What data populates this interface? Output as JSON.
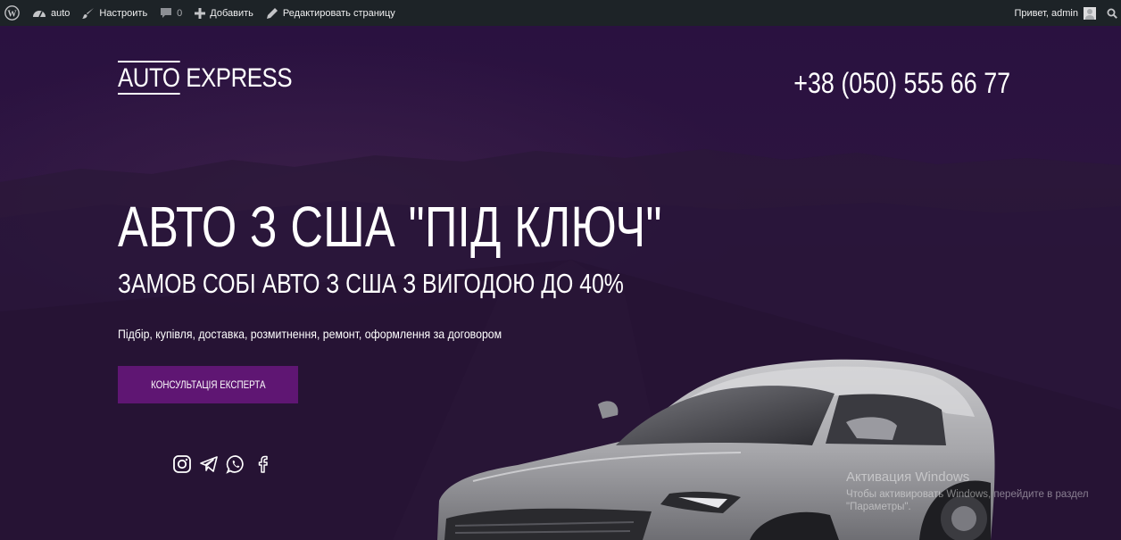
{
  "adminbar": {
    "site_name": "auto",
    "customize": "Настроить",
    "comments_count": "0",
    "new": "Добавить",
    "edit_page": "Редактировать страницу",
    "greeting": "Привет, admin"
  },
  "header": {
    "logo_part1": "AUTO",
    "logo_part2": "EXPRESS",
    "phone": "+38 (050) 555 66 77"
  },
  "hero": {
    "title": "АВТО З США \"ПІД КЛЮЧ\"",
    "subtitle": "ЗАМОВ СОБІ АВТО З США З ВИГОДОЮ ДО 40%",
    "description": "Підбір, купівля, доставка, розмитнення, ремонт, оформлення за договором",
    "cta": "КОНСУЛЬТАЦІЯ ЕКСПЕРТА"
  },
  "social": [
    "instagram-icon",
    "telegram-icon",
    "whatsapp-icon",
    "facebook-icon"
  ],
  "watermark": {
    "line1": "Активация Windows",
    "line2": "Чтобы активировать Windows, перейдите в раздел",
    "line3": "\"Параметры\"."
  },
  "colors": {
    "adminbar_bg": "#1d2327",
    "hero_bg": "#2a1140",
    "cta_bg": "#5f1673",
    "text": "#ffffff"
  }
}
